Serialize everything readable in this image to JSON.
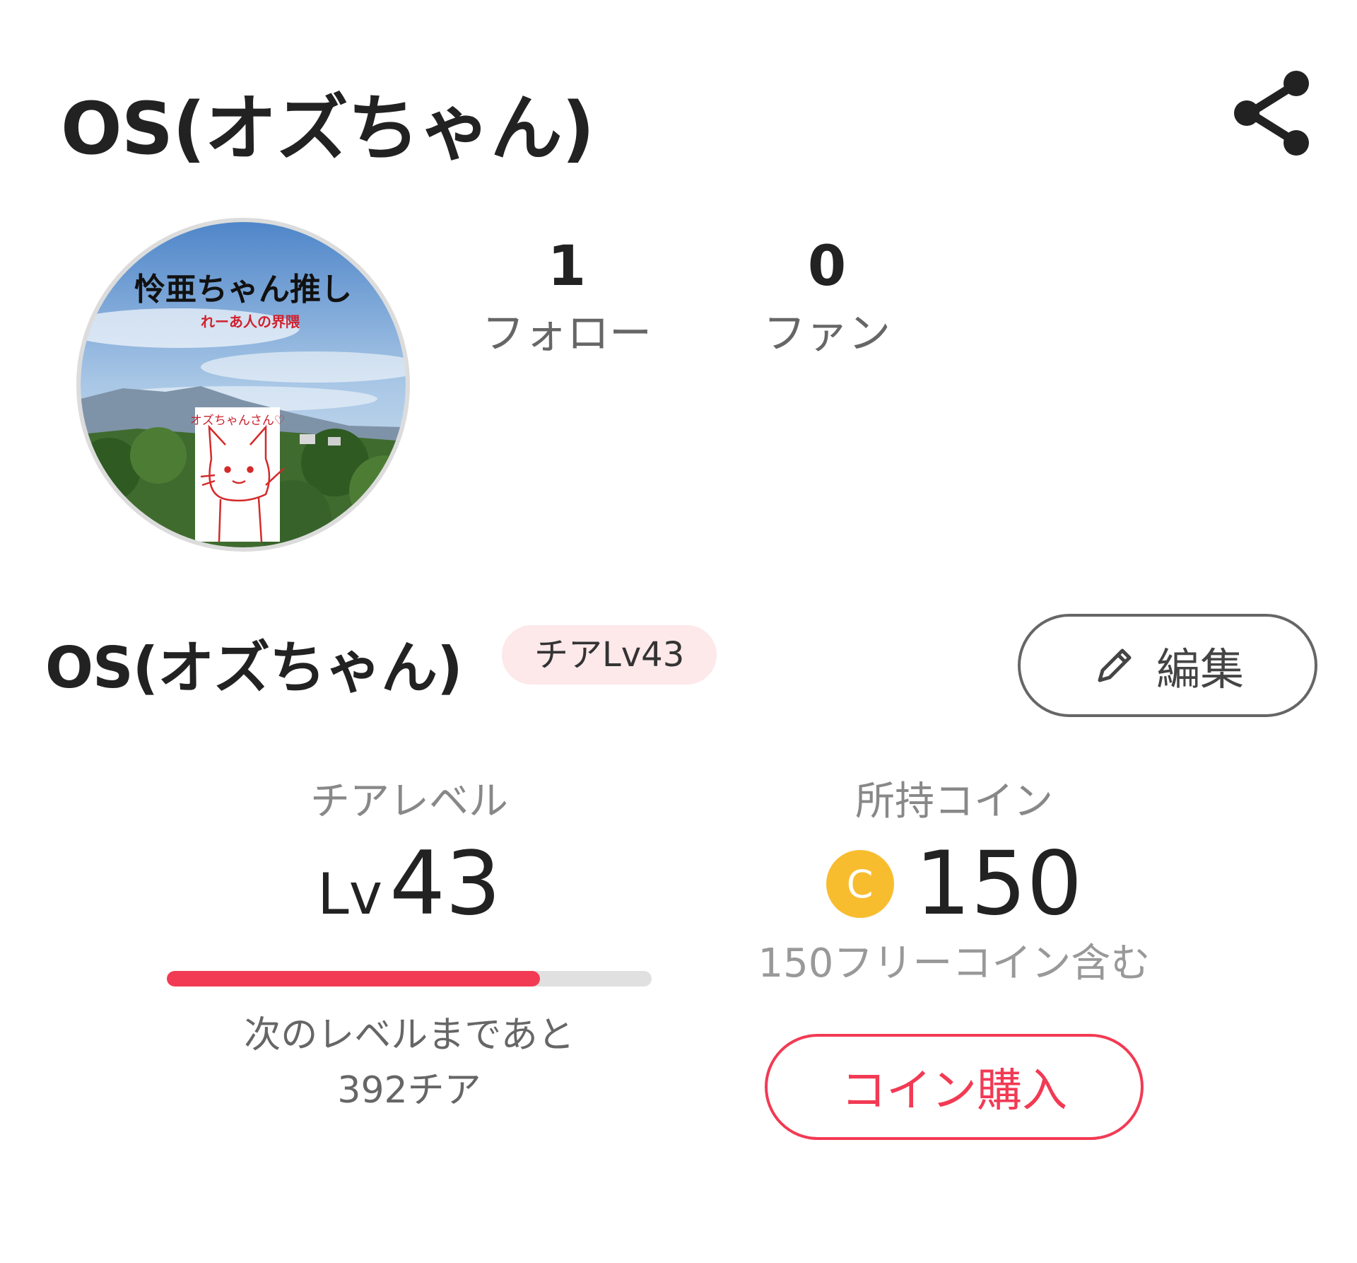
{
  "header": {
    "title": "OS(オズちゃん)",
    "share_icon": "share-icon"
  },
  "avatar": {
    "image_text_main": "怜亜ちゃん推し",
    "image_text_sub": "れーあ人の界隈",
    "image_text_handwritten": "オズちゃんさん♡"
  },
  "stats": {
    "follow": {
      "count": "1",
      "label": "フォロー"
    },
    "fans": {
      "count": "0",
      "label": "ファン"
    }
  },
  "profile": {
    "name": "OS(オズちゃん)",
    "badge": "チアLv43",
    "edit_label": "編集",
    "edit_icon": "pencil-icon"
  },
  "cheer": {
    "label": "チアレベル",
    "prefix": "Lv",
    "level": "43",
    "progress_fraction": 0.77,
    "next_line1": "次のレベルまであと",
    "next_line2": "392チア"
  },
  "coins": {
    "label": "所持コイン",
    "icon_letter": "C",
    "amount": "150",
    "free_note": "150フリーコイン含む",
    "buy_label": "コイン購入"
  },
  "colors": {
    "accent": "#f23a54",
    "coin": "#f8bd2f",
    "badge_bg": "#fde8ea"
  }
}
